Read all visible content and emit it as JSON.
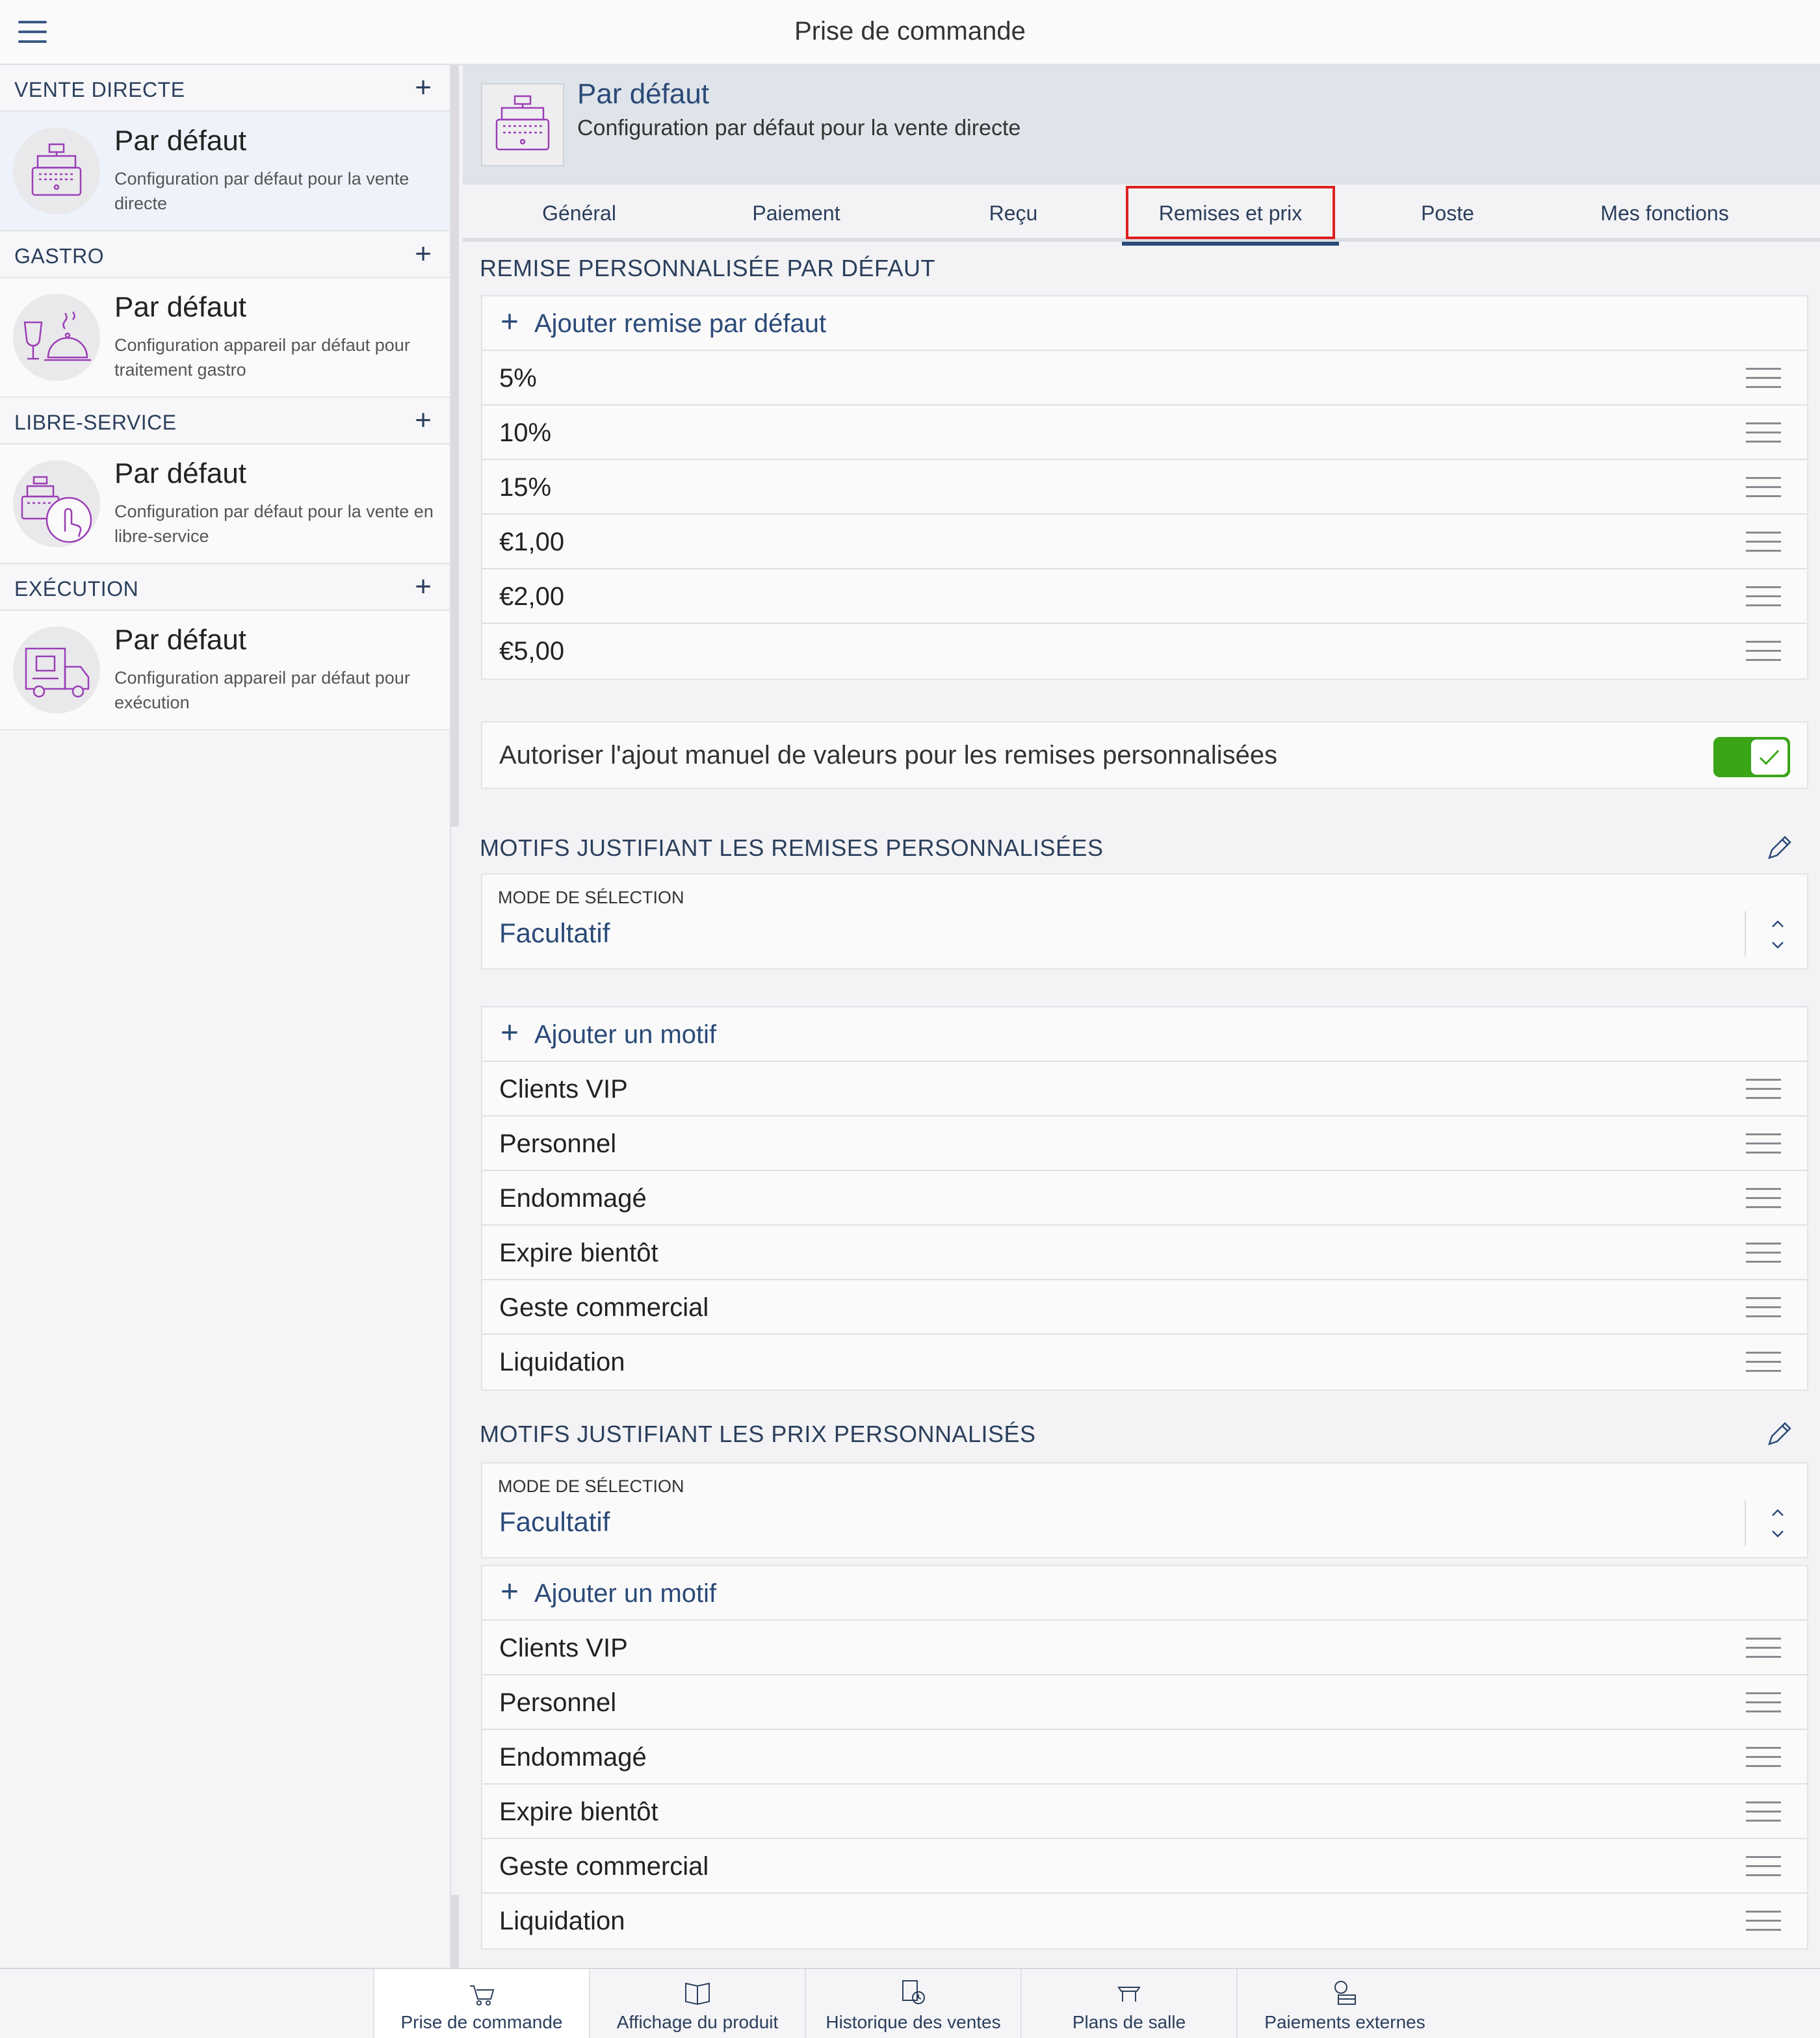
{
  "app": {
    "title": "Prise de commande"
  },
  "sidebar": {
    "sections": [
      {
        "label": "VENTE DIRECTE",
        "entry": {
          "name": "Par défaut",
          "description": "Configuration par défaut pour la vente directe",
          "icon": "cash-register-icon"
        }
      },
      {
        "label": "GASTRO",
        "entry": {
          "name": "Par défaut",
          "description": "Configuration appareil par défaut pour traitement gastro",
          "icon": "gastro-cloche-icon"
        }
      },
      {
        "label": "LIBRE-SERVICE",
        "entry": {
          "name": "Par défaut",
          "description": "Configuration par défaut pour la vente en libre-service",
          "icon": "self-service-touch-icon"
        }
      },
      {
        "label": "EXÉCUTION",
        "entry": {
          "name": "Par défaut",
          "description": "Configuration appareil par défaut pour exécution",
          "icon": "delivery-truck-icon"
        }
      }
    ]
  },
  "main": {
    "header": {
      "title": "Par défaut",
      "subtitle": "Configuration par défaut pour la vente directe"
    },
    "tabs": [
      "Général",
      "Paiement",
      "Reçu",
      "Remises et prix",
      "Poste",
      "Mes fonctions"
    ],
    "active_tab": "Remises et prix",
    "discount_section": {
      "title": "REMISE PERSONNALISÉE PAR DÉFAUT",
      "add_label": "Ajouter remise par défaut",
      "items": [
        "5%",
        "10%",
        "15%",
        "€1,00",
        "€2,00",
        "€5,00"
      ]
    },
    "manual_toggle": {
      "label": "Autoriser l'ajout manuel de valeurs pour les remises personnalisées",
      "on": true
    },
    "discount_reasons": {
      "title": "MOTIFS JUSTIFIANT LES REMISES PERSONNALISÉES",
      "select_label": "MODE DE SÉLECTION",
      "select_value": "Facultatif",
      "add_label": "Ajouter un motif",
      "items": [
        "Clients VIP",
        "Personnel",
        "Endommagé",
        "Expire bientôt",
        "Geste commercial",
        "Liquidation"
      ]
    },
    "price_reasons": {
      "title": "MOTIFS JUSTIFIANT LES PRIX PERSONNALISÉS",
      "select_label": "MODE DE SÉLECTION",
      "select_value": "Facultatif",
      "add_label": "Ajouter un motif",
      "items": [
        "Clients VIP",
        "Personnel",
        "Endommagé",
        "Expire bientôt",
        "Geste commercial",
        "Liquidation"
      ]
    }
  },
  "bottom_nav": {
    "items": [
      "Prise de commande",
      "Affichage du produit",
      "Historique des ventes",
      "Plans de salle",
      "Paiements externes"
    ],
    "active": "Prise de commande"
  },
  "colors": {
    "accent": "#2b4a78",
    "toggle_on": "#3aa517",
    "highlight": "#e02020",
    "icon_purple": "#9b3fb5"
  }
}
